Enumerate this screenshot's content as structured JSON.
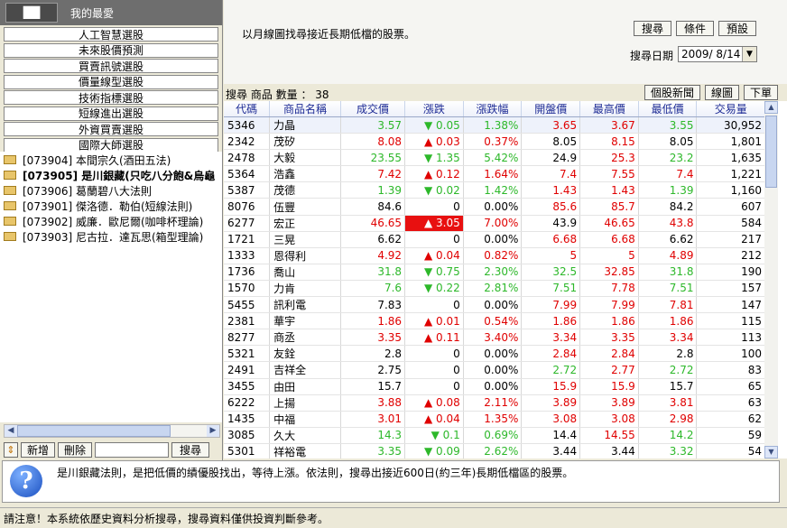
{
  "left_panel": {
    "tab_active": "██",
    "tab_favorites": "我的最愛",
    "categories": [
      "人工智慧選股",
      "未來股價預測",
      "買賣訊號選股",
      "價量線型選股",
      "技術指標選股",
      "短線進出選股",
      "外資買賣選股",
      "國際大師選股"
    ],
    "tree": [
      {
        "label": "[073904] 本間宗久(酒田五法)",
        "selected": false
      },
      {
        "label": "[073905] 是川銀藏(只吃八分飽&烏龜",
        "selected": true
      },
      {
        "label": "[073906] 葛蘭碧八大法則",
        "selected": false
      },
      {
        "label": "[073901] 傑洛德．勒伯(短線法則)",
        "selected": false
      },
      {
        "label": "[073902] 威廉．歐尼爾(咖啡杯理論)",
        "selected": false
      },
      {
        "label": "[073903] 尼古拉．達瓦思(箱型理論)",
        "selected": false
      }
    ],
    "add_label": "新增",
    "delete_label": "刪除",
    "search_label": "搜尋",
    "search_value": ""
  },
  "header": {
    "description": "以月線圖找尋接近長期低檔的股票。",
    "search_btn": "搜尋",
    "condition_btn": "條件",
    "default_btn": "預設",
    "date_label": "搜尋日期",
    "date_value": "2009/ 8/14"
  },
  "results": {
    "title": "搜尋 商品 數量 ： 38",
    "news_btn": "個股新聞",
    "chart_btn": "線圖",
    "next_btn": "下單",
    "columns": [
      "代碼",
      "商品名稱",
      "成交價",
      "漲跌",
      "漲跌幅",
      "開盤價",
      "最高價",
      "最低價",
      "交易量"
    ],
    "rows": [
      [
        "5346",
        "力晶",
        "3.57",
        "▼ 0.05",
        "1.38%",
        "3.65",
        "3.67",
        "3.55",
        "30,952",
        "g",
        "r",
        "r",
        "g"
      ],
      [
        "2342",
        "茂矽",
        "8.08",
        "▲ 0.03",
        "0.37%",
        "8.05",
        "8.15",
        "8.05",
        "1,801",
        "r",
        "k",
        "r",
        "k"
      ],
      [
        "2478",
        "大毅",
        "23.55",
        "▼ 1.35",
        "5.42%",
        "24.9",
        "25.3",
        "23.2",
        "1,635",
        "g",
        "k",
        "r",
        "g"
      ],
      [
        "5364",
        "浩鑫",
        "7.42",
        "▲ 0.12",
        "1.64%",
        "7.4",
        "7.55",
        "7.4",
        "1,221",
        "r",
        "r",
        "r",
        "r"
      ],
      [
        "5387",
        "茂德",
        "1.39",
        "▼ 0.02",
        "1.42%",
        "1.43",
        "1.43",
        "1.39",
        "1,160",
        "g",
        "r",
        "r",
        "g"
      ],
      [
        "8076",
        "伍豐",
        "84.6",
        "0",
        "0.00%",
        "85.6",
        "85.7",
        "84.2",
        "607",
        "k",
        "r",
        "r",
        "k"
      ],
      [
        "6277",
        "宏正",
        "46.65",
        "▲ 3.05",
        "7.00%",
        "43.9",
        "46.65",
        "43.8",
        "584",
        "r",
        "k",
        "r",
        "r"
      ],
      [
        "1721",
        "三晃",
        "6.62",
        "0",
        "0.00%",
        "6.68",
        "6.68",
        "6.62",
        "217",
        "k",
        "r",
        "r",
        "k"
      ],
      [
        "1333",
        "恩得利",
        "4.92",
        "▲ 0.04",
        "0.82%",
        "5",
        "5",
        "4.89",
        "212",
        "r",
        "r",
        "r",
        "r"
      ],
      [
        "1736",
        "喬山",
        "31.8",
        "▼ 0.75",
        "2.30%",
        "32.5",
        "32.85",
        "31.8",
        "190",
        "g",
        "g",
        "r",
        "g"
      ],
      [
        "1570",
        "力肯",
        "7.6",
        "▼ 0.22",
        "2.81%",
        "7.51",
        "7.78",
        "7.51",
        "157",
        "g",
        "g",
        "r",
        "g"
      ],
      [
        "5455",
        "訊利電",
        "7.83",
        "0",
        "0.00%",
        "7.99",
        "7.99",
        "7.81",
        "147",
        "k",
        "r",
        "r",
        "r"
      ],
      [
        "2381",
        "華宇",
        "1.86",
        "▲ 0.01",
        "0.54%",
        "1.86",
        "1.86",
        "1.86",
        "115",
        "r",
        "r",
        "r",
        "r"
      ],
      [
        "8277",
        "商丞",
        "3.35",
        "▲ 0.11",
        "3.40%",
        "3.34",
        "3.35",
        "3.34",
        "113",
        "r",
        "r",
        "r",
        "r"
      ],
      [
        "5321",
        "友銓",
        "2.8",
        "0",
        "0.00%",
        "2.84",
        "2.84",
        "2.8",
        "100",
        "k",
        "r",
        "r",
        "k"
      ],
      [
        "2491",
        "吉祥全",
        "2.75",
        "0",
        "0.00%",
        "2.72",
        "2.77",
        "2.72",
        "83",
        "k",
        "g",
        "r",
        "g"
      ],
      [
        "3455",
        "由田",
        "15.7",
        "0",
        "0.00%",
        "15.9",
        "15.9",
        "15.7",
        "65",
        "k",
        "r",
        "r",
        "k"
      ],
      [
        "6222",
        "上揚",
        "3.88",
        "▲ 0.08",
        "2.11%",
        "3.89",
        "3.89",
        "3.81",
        "63",
        "r",
        "r",
        "r",
        "r"
      ],
      [
        "1435",
        "中福",
        "3.01",
        "▲ 0.04",
        "1.35%",
        "3.08",
        "3.08",
        "2.98",
        "62",
        "r",
        "r",
        "r",
        "r"
      ],
      [
        "3085",
        "久大",
        "14.3",
        "▼ 0.1",
        "0.69%",
        "14.4",
        "14.55",
        "14.2",
        "59",
        "g",
        "k",
        "r",
        "g"
      ],
      [
        "5301",
        "祥裕電",
        "3.35",
        "▼ 0.09",
        "2.62%",
        "3.44",
        "3.44",
        "3.32",
        "54",
        "g",
        "k",
        "k",
        "g"
      ]
    ]
  },
  "info": {
    "text": "是川銀藏法則，是把低價的績優股找出，等待上漲。依法則，搜尋出接近600日(約三年)長期低檔區的股票。"
  },
  "status": {
    "text": "請注意！本系統依歷史資料分析搜尋，搜尋資料僅供投資判斷參考。"
  }
}
